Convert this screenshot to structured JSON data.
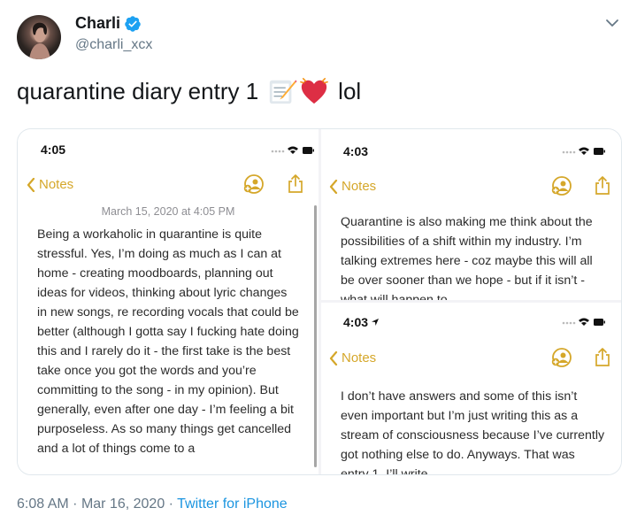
{
  "author": {
    "name": "Charli",
    "handle": "@charli_xcx"
  },
  "icons": {
    "verified": "verified-badge-icon",
    "more": "chevron-down-icon",
    "emoji_1": "memo-emoji",
    "emoji_2": "beating-heart-emoji"
  },
  "tweet": {
    "text_before": "quarantine diary entry 1",
    "text_after": "lol"
  },
  "screenshots": {
    "left": {
      "time": "4:05",
      "back_label": "Notes",
      "date": "March 15, 2020 at 4:05 PM",
      "body": "Being a workaholic in quarantine is quite stressful. Yes, I’m doing as much as I can at home - creating moodboards, planning out ideas for videos, thinking about lyric changes in new songs, re recording vocals that could be better (although I gotta say I fucking hate doing this and I rarely do it - the first take is the best take once you got the words and you’re committing to the song - in my opinion). But generally, even after one day - I’m feeling a bit purposeless. As so many things get cancelled and a lot of things come to a"
    },
    "right_top": {
      "time": "4:03",
      "back_label": "Notes",
      "body": "Quarantine is also making me think about the possibilities of a shift within my industry. I’m talking extremes here - coz maybe this will all be over sooner than we hope - but if it isn’t - what will happen to"
    },
    "right_bottom": {
      "time": "4:03",
      "back_label": "Notes",
      "body": "I don’t have answers and some of this isn’t even important but I’m just writing this as a stream of consciousness because I’ve currently got nothing else to do. Anyways. That was entry 1. I’ll write"
    }
  },
  "meta": {
    "time": "6:08 AM",
    "sep": "·",
    "date": "Mar 16, 2020",
    "source": "Twitter for iPhone"
  },
  "colors": {
    "notes_accent": "#d5a72a",
    "verified_blue": "#1da1f2",
    "link_blue": "#1b95e0"
  }
}
